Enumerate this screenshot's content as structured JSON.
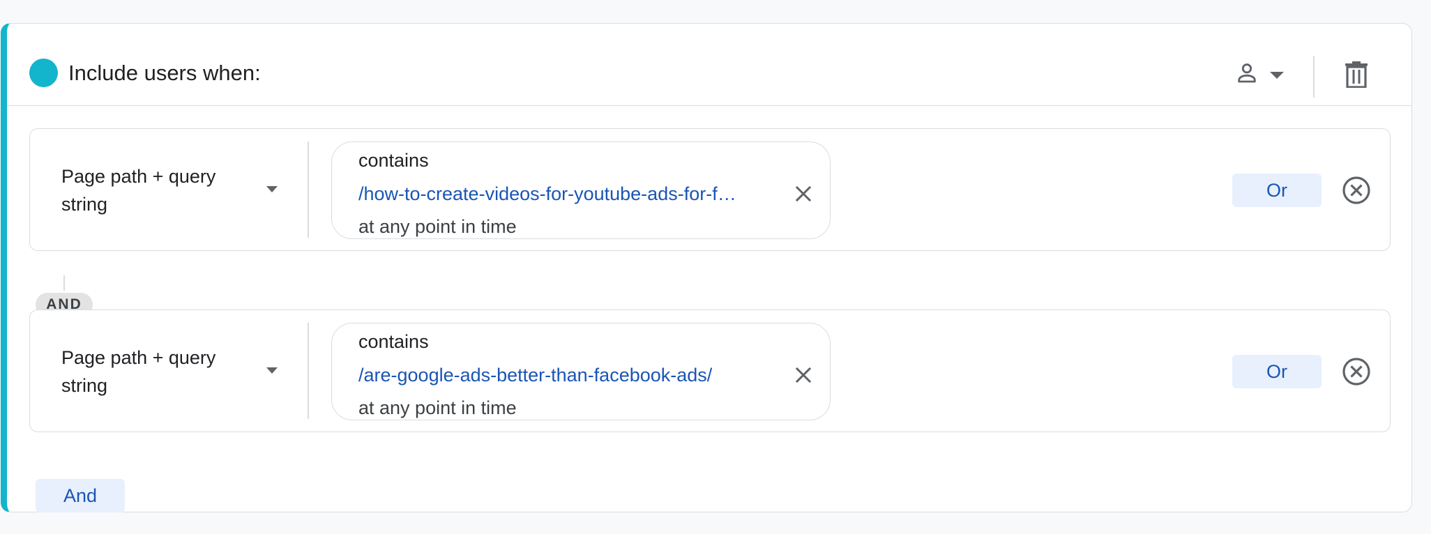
{
  "header": {
    "title": "Include users when:",
    "accent_color": "#12b5cb",
    "scope_icon": "person-icon",
    "delete_icon": "trash-icon"
  },
  "conditions": [
    {
      "dimension": "Page path + query string",
      "operator": "contains",
      "value": "/how-to-create-videos-for-youtube-ads-for-f…",
      "time_scope": "at any point in time",
      "or_label": "Or"
    },
    {
      "dimension": "Page path + query string",
      "operator": "contains",
      "value": "/are-google-ads-better-than-facebook-ads/",
      "time_scope": "at any point in time",
      "or_label": "Or"
    }
  ],
  "connector_label": "AND",
  "and_button_label": "And",
  "colors": {
    "accent": "#12b5cb",
    "link": "#1a55b4",
    "button_bg": "#e8f0fe"
  }
}
